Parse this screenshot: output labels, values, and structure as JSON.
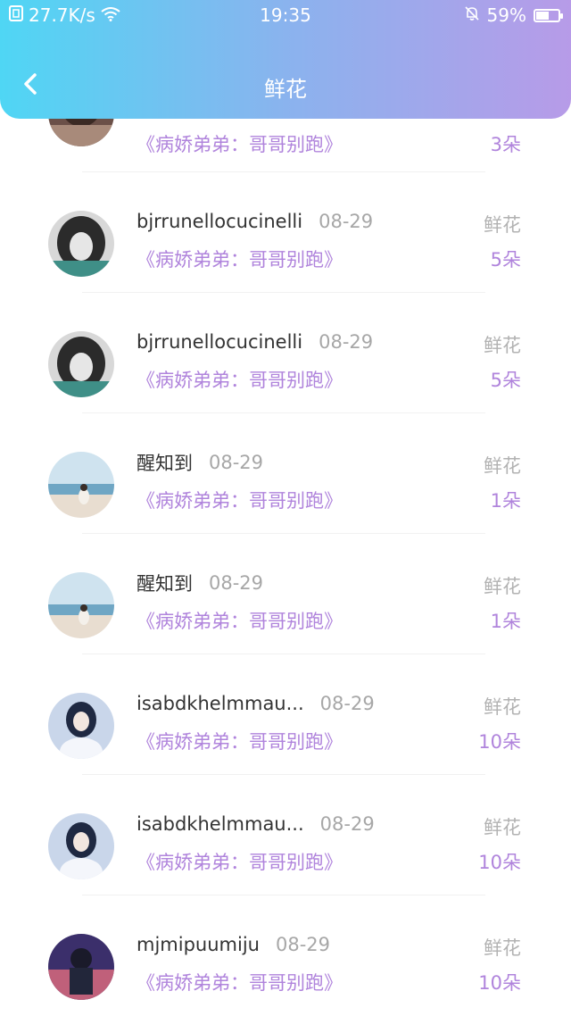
{
  "status_bar": {
    "net_speed": "27.7K/s",
    "time": "19:35",
    "battery_pct": "59%",
    "battery_level": 0.59
  },
  "nav": {
    "title": "鲜花"
  },
  "colors": {
    "accent": "#b084dc",
    "header_start": "#4fd6f4",
    "header_end": "#b79be8"
  },
  "partial_row": {
    "book": "《病娇弟弟：哥哥别跑》",
    "count": "3朵"
  },
  "rows": [
    {
      "name": "bjrrunellocucinelli",
      "date": "08-29",
      "type": "鲜花",
      "book": "《病娇弟弟：哥哥别跑》",
      "count": "5朵"
    },
    {
      "name": "bjrrunellocucinelli",
      "date": "08-29",
      "type": "鲜花",
      "book": "《病娇弟弟：哥哥别跑》",
      "count": "5朵"
    },
    {
      "name": "醒知到",
      "date": "08-29",
      "type": "鲜花",
      "book": "《病娇弟弟：哥哥别跑》",
      "count": "1朵"
    },
    {
      "name": "醒知到",
      "date": "08-29",
      "type": "鲜花",
      "book": "《病娇弟弟：哥哥别跑》",
      "count": "1朵"
    },
    {
      "name": "isabdkhelmmau...",
      "date": "08-29",
      "type": "鲜花",
      "book": "《病娇弟弟：哥哥别跑》",
      "count": "10朵"
    },
    {
      "name": "isabdkhelmmau...",
      "date": "08-29",
      "type": "鲜花",
      "book": "《病娇弟弟：哥哥别跑》",
      "count": "10朵"
    },
    {
      "name": "mjmipuumiju",
      "date": "08-29",
      "type": "鲜花",
      "book": "《病娇弟弟：哥哥别跑》",
      "count": "10朵"
    }
  ]
}
